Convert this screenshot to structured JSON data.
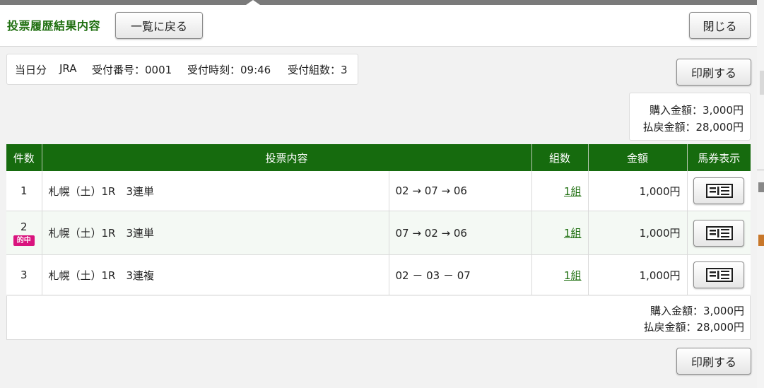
{
  "header": {
    "title": "投票履歴結果内容",
    "back_label": "一覧に戻る",
    "close_label": "閉じる"
  },
  "info": {
    "day": "当日分",
    "org": "JRA",
    "receipt_no": "受付番号：0001",
    "receipt_time": "受付時刻：09:46",
    "receipt_count": "受付組数：3"
  },
  "print_label": "印刷する",
  "summary": {
    "purchase": "購入金額：3,000円",
    "payout": "払戻金額：28,000円"
  },
  "table": {
    "headers": [
      "件数",
      "投票内容",
      "組数",
      "金額",
      "馬券表示"
    ],
    "rows": [
      {
        "num": "1",
        "race": "札幌（土）1R　3連単",
        "selection": "02 → 07 → 06",
        "kumi": "1組",
        "amount": "1,000円",
        "hit": ""
      },
      {
        "num": "2",
        "race": "札幌（土）1R　3連単",
        "selection": "07 → 02 → 06",
        "kumi": "1組",
        "amount": "1,000円",
        "hit": "的中"
      },
      {
        "num": "3",
        "race": "札幌（土）1R　3連複",
        "selection": "02 － 03 － 07",
        "kumi": "1組",
        "amount": "1,000円",
        "hit": ""
      }
    ]
  },
  "footer": {
    "purchase": "購入金額：3,000円",
    "payout": "払戻金額：28,000円"
  },
  "colors": {
    "brand_green": "#166b0e",
    "title_green": "#1f6f10",
    "hit_pink": "#d9147e"
  },
  "icons": {
    "ticket": "ticket-icon"
  }
}
